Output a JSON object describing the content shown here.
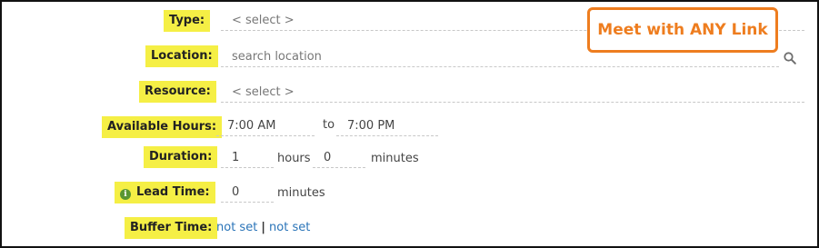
{
  "badge": {
    "text": "Meet with ANY Link",
    "color": "#ee7d1f"
  },
  "form": {
    "type": {
      "label": "Type:",
      "placeholder": "< select >"
    },
    "location": {
      "label": "Location:",
      "placeholder": "search location",
      "icon": "search-icon"
    },
    "resource": {
      "label": "Resource:",
      "placeholder": "< select >"
    },
    "available_hours": {
      "label": "Available Hours:",
      "start": "7:00 AM",
      "to_label": "to",
      "end": "7:00 PM"
    },
    "duration": {
      "label": "Duration:",
      "hours_value": "1",
      "hours_unit": "hours",
      "minutes_value": "0",
      "minutes_unit": "minutes"
    },
    "lead_time": {
      "label": "Lead Time:",
      "icon": "info-icon",
      "value": "0",
      "unit": "minutes"
    },
    "buffer_time": {
      "label": "Buffer Time:",
      "before": "not set",
      "separator": "|",
      "after": "not set"
    }
  },
  "colors": {
    "label_highlight": "#f5ef45",
    "link": "#2a74b8",
    "info_icon": "#5a9632"
  }
}
